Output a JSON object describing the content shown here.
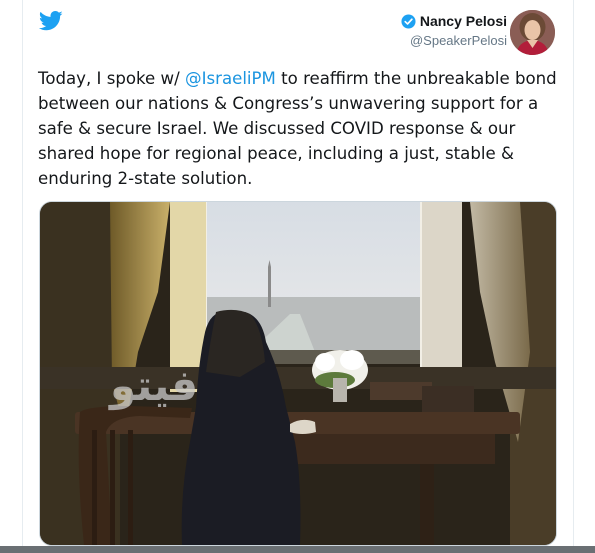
{
  "tweet": {
    "author_name": "Nancy Pelosi",
    "author_handle": "@SpeakerPelosi",
    "text_before": "Today, I spoke w/ ",
    "mention": "@IsraeliPM",
    "text_after": " to reaffirm the unbreakable bond between our nations & Congress’s unwavering support for a safe & secure Israel. We discussed COVID response & our shared hope for regional peace, including a just, stable & enduring 2-state solution."
  },
  "icons": {
    "logo": "twitter-bird-icon",
    "verified": "verified-badge-icon"
  },
  "colors": {
    "brand": "#1da1f2",
    "mention": "#1b95e0",
    "text": "#14171a",
    "secondary": "#657786"
  },
  "watermark": "فيتو"
}
